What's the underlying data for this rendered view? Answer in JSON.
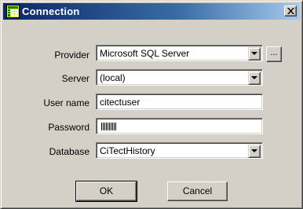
{
  "window": {
    "title": "Connection",
    "close_glyph": "✕"
  },
  "form": {
    "provider": {
      "label": "Provider",
      "value": "Microsoft SQL Server",
      "browse_label": "..."
    },
    "server": {
      "label": "Server",
      "value": "(local)"
    },
    "username": {
      "label": "User name",
      "value": "citectuser"
    },
    "password": {
      "label": "Password",
      "masked_length": 10
    },
    "database": {
      "label": "Database",
      "value": "CiTectHistory"
    }
  },
  "buttons": {
    "ok_label": "OK",
    "cancel_label": "Cancel"
  },
  "colors": {
    "titlebar_start": "#0a246a",
    "titlebar_end": "#a6caf0",
    "dialog_face": "#d4d0c8"
  },
  "icons": {
    "app": "grid-table-icon",
    "close": "close-icon",
    "dropdown": "chevron-down-icon"
  }
}
